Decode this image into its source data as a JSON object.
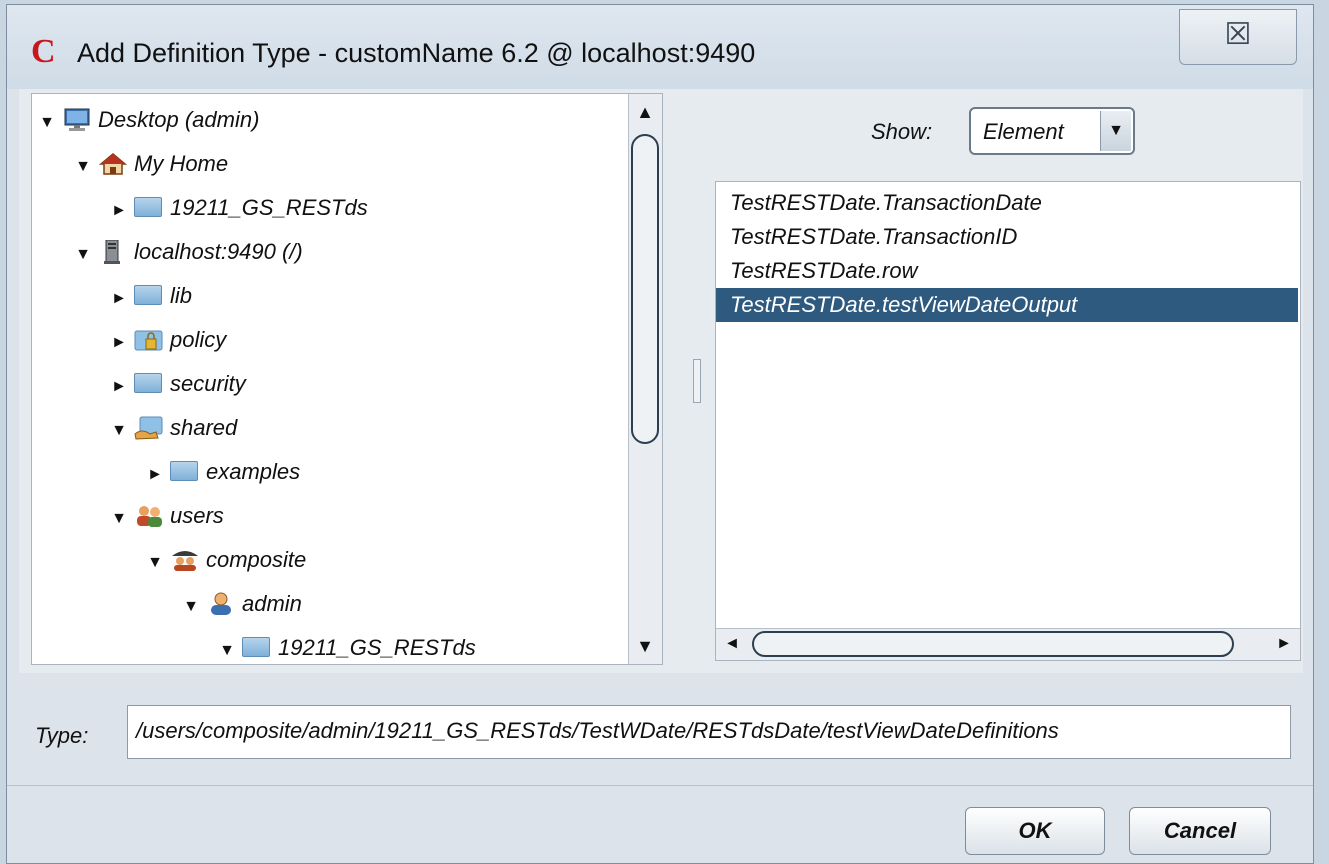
{
  "window": {
    "app_icon_letter": "C",
    "title": "Add Definition Type - customName 6.2 @ localhost:9490",
    "close_symbol": "☒"
  },
  "tree": {
    "items": [
      {
        "label": "Desktop (admin)",
        "toggle": "▼",
        "icon": "monitor-icon"
      },
      {
        "label": "My Home",
        "toggle": "▼",
        "icon": "home-icon"
      },
      {
        "label": "19211_GS_RESTds",
        "toggle": "►",
        "icon": "folder-icon"
      },
      {
        "label": "localhost:9490 (/)",
        "toggle": "▼",
        "icon": "server-icon"
      },
      {
        "label": "lib",
        "toggle": "►",
        "icon": "folder-icon"
      },
      {
        "label": "policy",
        "toggle": "►",
        "icon": "locked-folder-icon"
      },
      {
        "label": "security",
        "toggle": "►",
        "icon": "folder-icon"
      },
      {
        "label": "shared",
        "toggle": "▼",
        "icon": "shared-folder-icon"
      },
      {
        "label": "examples",
        "toggle": "►",
        "icon": "folder-icon"
      },
      {
        "label": "users",
        "toggle": "▼",
        "icon": "users-icon"
      },
      {
        "label": "composite",
        "toggle": "▼",
        "icon": "group-icon"
      },
      {
        "label": "admin",
        "toggle": "▼",
        "icon": "user-icon"
      },
      {
        "label": "19211_GS_RESTds",
        "toggle": "▼",
        "icon": "folder-icon"
      }
    ]
  },
  "show": {
    "label": "Show:",
    "value": "Element",
    "arrow": "▼"
  },
  "elements": {
    "items": [
      "TestRESTDate.TransactionDate",
      "TestRESTDate.TransactionID",
      "TestRESTDate.row",
      "TestRESTDate.testViewDateOutput"
    ],
    "selected_index": 3
  },
  "type_field": {
    "label": "Type:",
    "value": "/users/composite/admin/19211_GS_RESTds/TestWDate/RESTdsDate/testViewDateDefinitions"
  },
  "buttons": {
    "ok": "OK",
    "cancel": "Cancel"
  },
  "scroll": {
    "up": "▲",
    "down": "▼",
    "left": "◄",
    "right": "►"
  }
}
